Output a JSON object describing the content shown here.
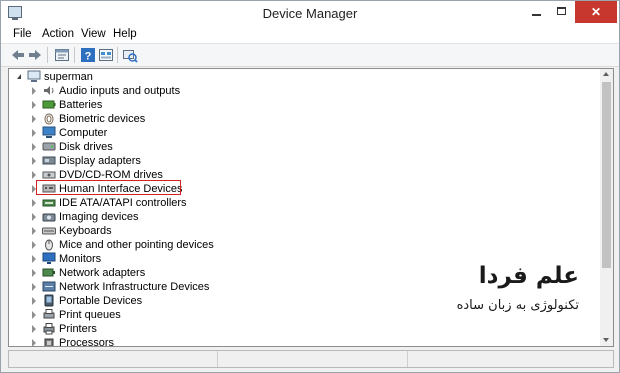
{
  "window": {
    "title": "Device Manager",
    "close_glyph": "✕"
  },
  "menu": [
    "File",
    "Action",
    "View",
    "Help"
  ],
  "toolbar": {
    "buttons": [
      "back-arrow-icon",
      "forward-arrow-icon",
      "properties-icon",
      "help-icon",
      "device-view-icon",
      "scan-hardware-icon"
    ]
  },
  "tree": {
    "root": "superman",
    "items": [
      {
        "label": "Audio inputs and outputs",
        "icon": "speaker-icon"
      },
      {
        "label": "Batteries",
        "icon": "battery-icon"
      },
      {
        "label": "Biometric devices",
        "icon": "fingerprint-icon"
      },
      {
        "label": "Computer",
        "icon": "computer-icon"
      },
      {
        "label": "Disk drives",
        "icon": "disk-drive-icon"
      },
      {
        "label": "Display adapters",
        "icon": "display-adapter-icon"
      },
      {
        "label": "DVD/CD-ROM drives",
        "icon": "dvd-drive-icon"
      },
      {
        "label": "Human Interface Devices",
        "icon": "hid-icon",
        "highlighted": true
      },
      {
        "label": "IDE ATA/ATAPI controllers",
        "icon": "ide-controller-icon"
      },
      {
        "label": "Imaging devices",
        "icon": "camera-icon"
      },
      {
        "label": "Keyboards",
        "icon": "keyboard-icon"
      },
      {
        "label": "Mice and other pointing devices",
        "icon": "mouse-icon"
      },
      {
        "label": "Monitors",
        "icon": "monitor-icon"
      },
      {
        "label": "Network adapters",
        "icon": "network-adapter-icon"
      },
      {
        "label": "Network Infrastructure Devices",
        "icon": "network-infrastructure-icon"
      },
      {
        "label": "Portable Devices",
        "icon": "portable-device-icon"
      },
      {
        "label": "Print queues",
        "icon": "print-queue-icon"
      },
      {
        "label": "Printers",
        "icon": "printer-icon"
      },
      {
        "label": "Processors",
        "icon": "processor-icon"
      }
    ]
  },
  "watermark": {
    "title": "علم فردا",
    "subtitle": "تکنولوژی به زبان ساده"
  },
  "colors": {
    "highlight": "#d62020",
    "close_button": "#c7372e"
  }
}
